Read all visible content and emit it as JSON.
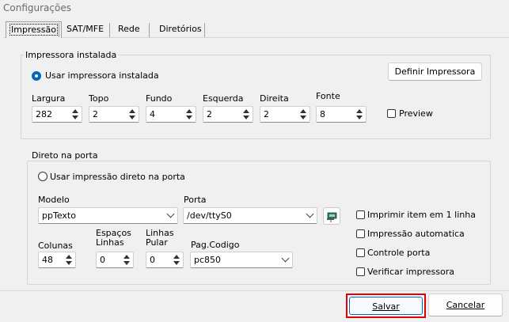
{
  "window": {
    "title": "Configurações"
  },
  "tabs": [
    {
      "label": "Impressão",
      "selected": true
    },
    {
      "label": "SAT/MFE"
    },
    {
      "label": "Rede"
    },
    {
      "label": "Diretórios"
    }
  ],
  "installed_printer": {
    "group_title": "Impressora instalada",
    "radio_label": "Usar impressora instalada",
    "define_button": "Definir Impressora",
    "fields": {
      "largura": {
        "label": "Largura",
        "value": "282"
      },
      "topo": {
        "label": "Topo",
        "value": "2"
      },
      "fundo": {
        "label": "Fundo",
        "value": "4"
      },
      "esquerda": {
        "label": "Esquerda",
        "value": "2"
      },
      "direita": {
        "label": "Direita",
        "value": "2"
      },
      "fonte": {
        "label": "Fonte",
        "value": "8"
      }
    },
    "preview_label": "Preview"
  },
  "direct_port": {
    "group_title": "Direto na porta",
    "radio_label": "Usar impressão direto na porta",
    "modelo": {
      "label": "Modelo",
      "value": "ppTexto"
    },
    "porta": {
      "label": "Porta",
      "value": "/dev/ttyS0"
    },
    "colunas": {
      "label": "Colunas",
      "value": "48"
    },
    "espacos": {
      "label_line1": "Espaços",
      "label_line2": "Linhas",
      "value": "0"
    },
    "linhas_pular": {
      "label_line1": "Linhas",
      "label_line2": "Pular",
      "value": "0"
    },
    "pag_codigo": {
      "label": "Pag.Codigo",
      "value": "pc850"
    },
    "checks": {
      "imprimir_item": "Imprimir item em 1 linha",
      "impressao_auto": "Impressão automatica",
      "controle_porta": "Controle porta",
      "verificar": "Verificar impressora"
    }
  },
  "footer": {
    "save": "Salvar",
    "cancel": "Cancelar"
  }
}
